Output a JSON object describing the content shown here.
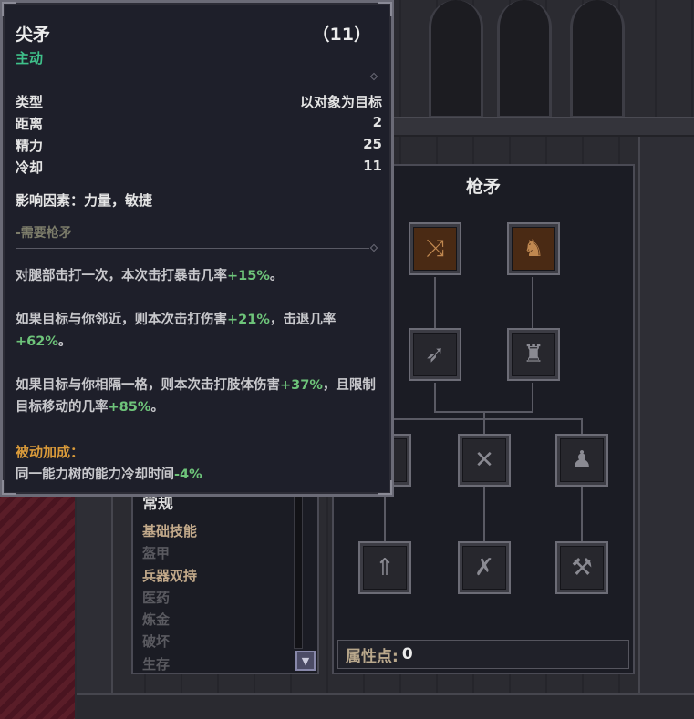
{
  "tooltip": {
    "title": "尖矛",
    "rank": "（11）",
    "skill_type": "主动",
    "stats": [
      {
        "label": "类型",
        "value": "以对象为目标"
      },
      {
        "label": "距离",
        "value": "2"
      },
      {
        "label": "精力",
        "value": "25"
      },
      {
        "label": "冷却",
        "value": "11"
      }
    ],
    "factors": "影响因素：力量，敏捷",
    "requirement": "-需要枪矛",
    "desc1": {
      "text": "对腿部击打一次，本次击打暴击几率",
      "v1": "+15%",
      "end": "。"
    },
    "desc2": {
      "text": "如果目标与你邻近，则本次击打伤害",
      "v1": "+21%",
      "mid": "，击退几率",
      "v2": "+62%",
      "end": "。"
    },
    "desc3": {
      "text": "如果目标与你相隔一格，则本次击打肢体伤害",
      "v1": "+37%",
      "mid": "，且限制目标移动的几率",
      "v2": "+85%",
      "end": "。"
    },
    "passive_title": "被动加成：",
    "passive_text": "同一能力树的能力冷却时间",
    "passive_value": "-4%"
  },
  "tree": {
    "title": "枪矛",
    "points_label": "属性点:",
    "points_value": "0"
  },
  "categories": {
    "header": "常规",
    "items": [
      "基础技能",
      "盔甲",
      "兵器双持",
      "医药",
      "炼金",
      "破坏",
      "生存"
    ],
    "active_flags": [
      true,
      false,
      true,
      false,
      false,
      false,
      false
    ]
  },
  "colors": {
    "green_text": "#3fc08a",
    "bonus_value": "#6ec47a",
    "passive_title": "#d99a3a"
  }
}
